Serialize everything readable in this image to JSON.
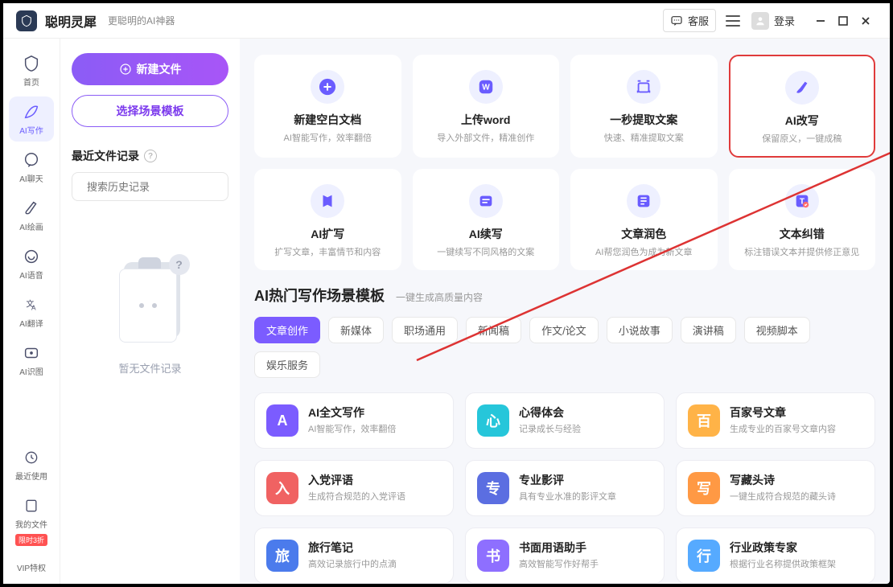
{
  "title": "聪明灵犀",
  "slogan": "更聪明的AI神器",
  "header": {
    "cs": "客服",
    "login": "登录"
  },
  "nav": [
    {
      "label": "首页"
    },
    {
      "label": "AI写作"
    },
    {
      "label": "AI聊天"
    },
    {
      "label": "AI绘画"
    },
    {
      "label": "AI语音"
    },
    {
      "label": "AI翻译"
    },
    {
      "label": "AI识图"
    },
    {
      "label": "最近使用"
    },
    {
      "label": "我的文件"
    },
    {
      "label": "VIP特权",
      "badge": "限时3折"
    }
  ],
  "leftPanel": {
    "newFile": "新建文件",
    "selectTpl": "选择场景模板",
    "recentHeading": "最近文件记录",
    "searchPlaceholder": "搜索历史记录",
    "emptyText": "暂无文件记录"
  },
  "topCards": [
    {
      "title": "新建空白文档",
      "sub": "AI智能写作，效率翻倍",
      "icon": "plus"
    },
    {
      "title": "上传word",
      "sub": "导入外部文件，精准创作",
      "icon": "word"
    },
    {
      "title": "一秒提取文案",
      "sub": "快速、精准提取文案",
      "icon": "extract"
    },
    {
      "title": "AI改写",
      "sub": "保留原义，一键成稿",
      "icon": "feather",
      "hl": true
    },
    {
      "title": "AI扩写",
      "sub": "扩写文章，丰富情节和内容",
      "icon": "expand"
    },
    {
      "title": "AI续写",
      "sub": "一键续写不同风格的文案",
      "icon": "continue"
    },
    {
      "title": "文章润色",
      "sub": "AI帮您润色为成为新文章",
      "icon": "polish"
    },
    {
      "title": "文本纠错",
      "sub": "标注错误文本并提供修正意见",
      "icon": "correct"
    }
  ],
  "section": {
    "title": "AI热门写作场景模板",
    "sub": "一键生成高质量内容"
  },
  "tabs": [
    "文章创作",
    "新媒体",
    "职场通用",
    "新闻稿",
    "作文/论文",
    "小说故事",
    "演讲稿",
    "视频脚本",
    "娱乐服务"
  ],
  "templates": [
    {
      "title": "AI全文写作",
      "sub": "AI智能写作，效率翻倍",
      "c": "c-purple"
    },
    {
      "title": "心得体会",
      "sub": "记录成长与经验",
      "c": "c-teal"
    },
    {
      "title": "百家号文章",
      "sub": "生成专业的百家号文章内容",
      "c": "c-orange"
    },
    {
      "title": "入党评语",
      "sub": "生成符合规范的入党评语",
      "c": "c-red"
    },
    {
      "title": "专业影评",
      "sub": "具有专业水准的影评文章",
      "c": "c-indigo"
    },
    {
      "title": "写藏头诗",
      "sub": "一键生成符合规范的藏头诗",
      "c": "c-amber"
    },
    {
      "title": "旅行笔记",
      "sub": "高效记录旅行中的点滴",
      "c": "c-blue"
    },
    {
      "title": "书面用语助手",
      "sub": "高效智能写作好帮手",
      "c": "c-violet"
    },
    {
      "title": "行业政策专家",
      "sub": "根据行业名称提供政策框架",
      "c": "c-sky"
    }
  ]
}
